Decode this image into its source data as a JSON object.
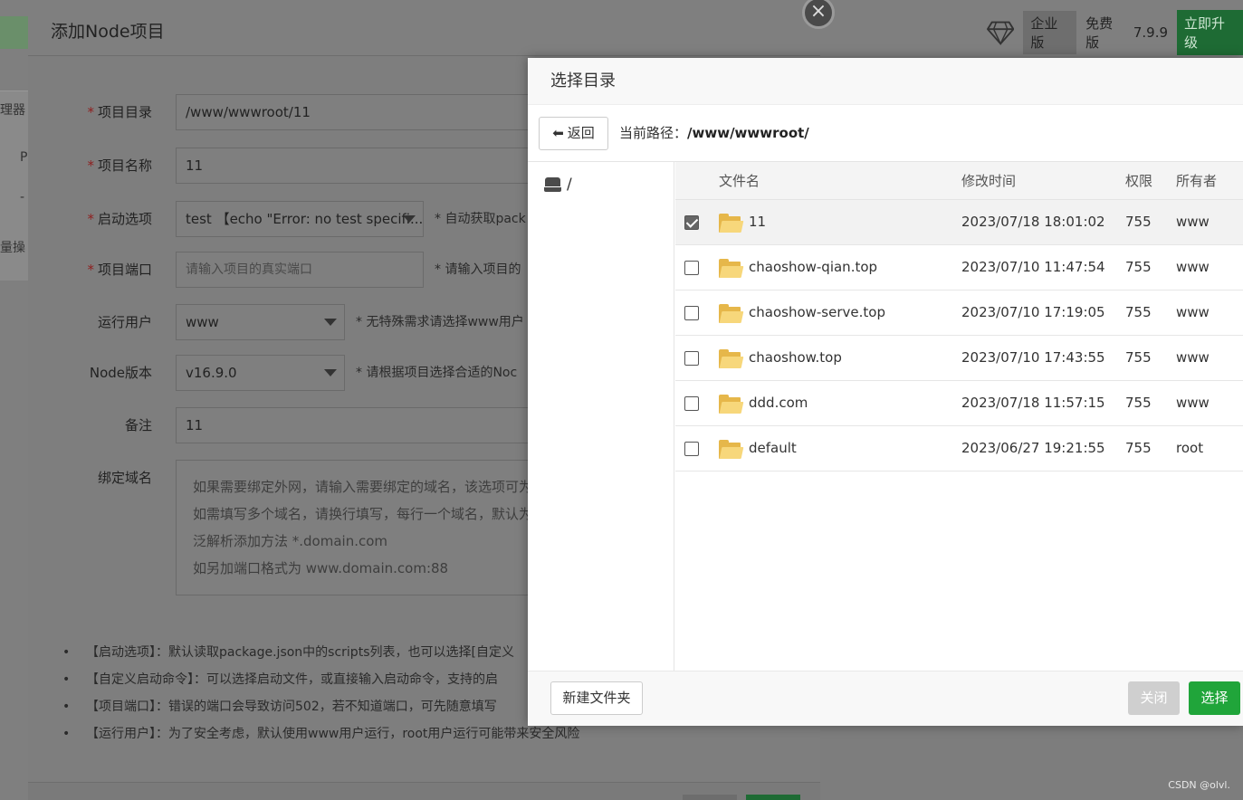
{
  "background": {
    "left_items": [
      "理器",
      "P",
      "-",
      "量操"
    ],
    "edition_label": "企业版",
    "free_label": "免费版",
    "version": "7.9.9",
    "upgrade_label": "立即升级",
    "watermark": "CSDN @olvl."
  },
  "main_dialog": {
    "title": "添加Node项目",
    "close_symbol": "×",
    "fields": {
      "project_dir": {
        "label": "项目目录",
        "value": "/www/wwwroot/11"
      },
      "project_name": {
        "label": "项目名称",
        "value": "11"
      },
      "start_option": {
        "label": "启动选项",
        "value": "test 【echo \"Error: no test specifi...",
        "hint": "* 自动获取pack"
      },
      "project_port": {
        "label": "项目端口",
        "placeholder": "请输入项目的真实端口",
        "hint": "* 请输入项目的"
      },
      "run_user": {
        "label": "运行用户",
        "value": "www",
        "hint": "* 无特殊需求请选择www用户"
      },
      "node_version": {
        "label": "Node版本",
        "value": "v16.9.0",
        "hint": "* 请根据项目选择合适的Noc"
      },
      "remark": {
        "label": "备注",
        "value": "11"
      },
      "domain": {
        "label": "绑定域名",
        "placeholder_lines": [
          "如果需要绑定外网，请输入需要绑定的域名，该选项可为",
          "如需填写多个域名，请换行填写，每行一个域名，默认为",
          "泛解析添加方法 *.domain.com",
          "如另加端口格式为 www.domain.com:88"
        ]
      }
    },
    "tips": [
      "【启动选项】：默认读取package.json中的scripts列表，也可以选择[自定义",
      "【自定义启动命令】：可以选择启动文件，或直接输入启动命令，支持的启",
      "【项目端口】：错误的端口会导致访问502，若不知道端口，可先随意填写",
      "【运行用户】：为了安全考虑，默认使用www用户运行，root用户运行可能带来安全风险"
    ]
  },
  "picker": {
    "title": "选择目录",
    "back_label": "返回",
    "path_prefix": "当前路径：",
    "current_path": "/www/wwwroot/",
    "tree_root": "/",
    "columns": {
      "name": "文件名",
      "mtime": "修改时间",
      "perm": "权限",
      "owner": "所有者"
    },
    "rows": [
      {
        "name": "11",
        "mtime": "2023/07/18 18:01:02",
        "perm": "755",
        "owner": "www",
        "checked": true
      },
      {
        "name": "chaoshow-qian.top",
        "mtime": "2023/07/10 11:47:54",
        "perm": "755",
        "owner": "www",
        "checked": false
      },
      {
        "name": "chaoshow-serve.top",
        "mtime": "2023/07/10 17:19:05",
        "perm": "755",
        "owner": "www",
        "checked": false
      },
      {
        "name": "chaoshow.top",
        "mtime": "2023/07/10 17:43:55",
        "perm": "755",
        "owner": "www",
        "checked": false
      },
      {
        "name": "ddd.com",
        "mtime": "2023/07/18 11:57:15",
        "perm": "755",
        "owner": "www",
        "checked": false
      },
      {
        "name": "default",
        "mtime": "2023/06/27 19:21:55",
        "perm": "755",
        "owner": "root",
        "checked": false
      }
    ],
    "new_folder_label": "新建文件夹",
    "close_label": "关闭",
    "choose_label": "选择"
  },
  "colors": {
    "accent_green": "#20a53a",
    "required_red": "#8f1f1f",
    "folder_yellow": "#f7d77b"
  }
}
